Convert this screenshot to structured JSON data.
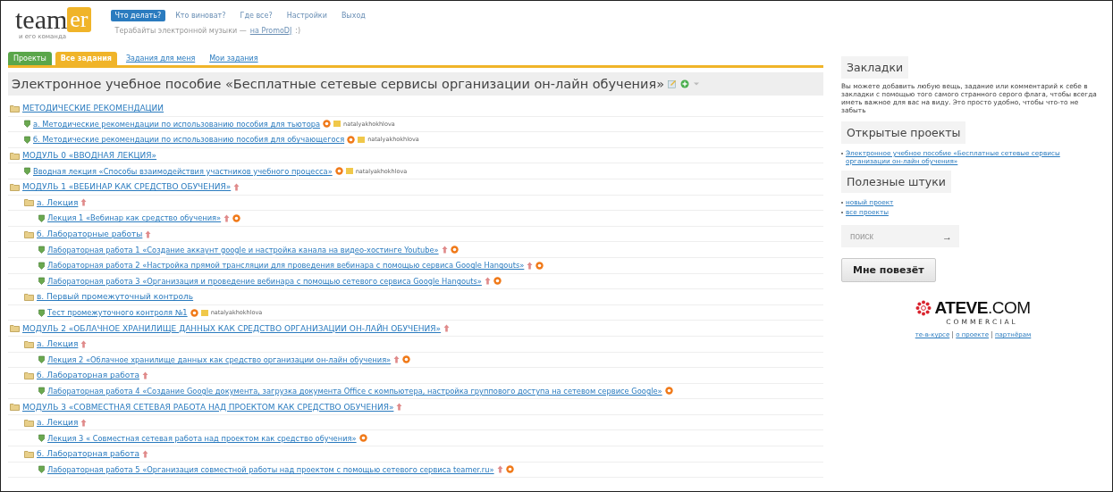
{
  "logo": {
    "word": "team",
    "badge": "er",
    "tagline": "и его команда"
  },
  "nav": [
    {
      "label": "Что делать?",
      "selected": true
    },
    {
      "label": "Кто виноват?",
      "selected": false
    },
    {
      "label": "Где все?",
      "selected": false
    },
    {
      "label": "Настройки",
      "selected": false
    },
    {
      "label": "Выход",
      "selected": false
    }
  ],
  "promo": {
    "text": "Терабайты электронной музыки —",
    "link": "на PromoDJ",
    "smile": ":)"
  },
  "tabs": [
    {
      "label": "Проекты",
      "kind": "green",
      "selected": false
    },
    {
      "label": "Все задания",
      "kind": "yellow",
      "selected": true
    },
    {
      "label": "Задания для меня",
      "kind": "link",
      "selected": false
    },
    {
      "label": "Мои задания",
      "kind": "link",
      "selected": false
    }
  ],
  "project_title": "Электронное учебное пособие «Бесплатные сетевые сервисы организации он-лайн обучения»",
  "tree": [
    {
      "kind": "folder",
      "title": "МЕТОДИЧЕСКИЕ РЕКОМЕНДАЦИИ",
      "up": false,
      "children": [
        {
          "kind": "task",
          "title": "а. Методические рекомендации по использованию пособия для тьютора",
          "up": false,
          "comment": true,
          "author": "natalyakhokhlova"
        },
        {
          "kind": "task",
          "title": "б. Методические рекомендации по использованию пособия для обучающегося",
          "up": false,
          "comment": true,
          "author": "natalyakhokhlova"
        }
      ]
    },
    {
      "kind": "folder",
      "title": "МОДУЛЬ 0 «ВВОДНАЯ ЛЕКЦИЯ»",
      "up": false,
      "children": [
        {
          "kind": "task",
          "title": "Вводная лекция «Способы взаимодействия участников учебного процесса»",
          "up": false,
          "comment": true,
          "author": "natalyakhokhlova"
        }
      ]
    },
    {
      "kind": "folder",
      "title": "МОДУЛЬ 1 «ВЕБИНАР КАК СРЕДСТВО ОБУЧЕНИЯ»",
      "up": true,
      "children": [
        {
          "kind": "folder",
          "title": "а. Лекция",
          "up": true,
          "children": [
            {
              "kind": "task",
              "title": "Лекция 1 «Вебинар как средство обучения»",
              "up": true,
              "comment": true
            }
          ]
        },
        {
          "kind": "folder",
          "title": "б. Лабораторные работы",
          "up": true,
          "children": [
            {
              "kind": "task",
              "title": "Лабораторная работа 1 «Создание аккаунт google и настройка канала на видео-хостинге Youtube»",
              "up": true,
              "comment": true
            },
            {
              "kind": "task",
              "title": "Лабораторная работа 2 «Настройка прямой трансляции для проведения вебинара с помощью сервиса Google Hangouts»",
              "up": true,
              "comment": true
            },
            {
              "kind": "task",
              "title": "Лабораторная работа 3 «Организация и проведение вебинара с помощью сетевого сервиса Google Hangouts»",
              "up": true,
              "comment": true
            }
          ]
        },
        {
          "kind": "folder",
          "title": "в. Первый промежуточный контроль",
          "up": false,
          "children": [
            {
              "kind": "task",
              "title": "Тест промежуточного контроля №1",
              "up": false,
              "comment": true,
              "author": "natalyakhokhlova"
            }
          ]
        }
      ]
    },
    {
      "kind": "folder",
      "title": "МОДУЛЬ 2 «ОБЛАЧНОЕ ХРАНИЛИЩЕ ДАННЫХ КАК СРЕДСТВО ОРГАНИЗАЦИИ ОН-ЛАЙН ОБУЧЕНИЯ»",
      "up": true,
      "children": [
        {
          "kind": "folder",
          "title": "а. Лекция",
          "up": true,
          "children": [
            {
              "kind": "task",
              "title": "Лекция 2 «Облачное хранилище данных как средство организации он-лайн обучения»",
              "up": true,
              "comment": true
            }
          ]
        },
        {
          "kind": "folder",
          "title": "б. Лабораторная работа",
          "up": true,
          "children": [
            {
              "kind": "task",
              "title": "Лабораторная работа 4 «Создание Google документа, загрузка документа Office с компьютера, настройка группового доступа на сетевом сервисе Google»",
              "up": false,
              "comment": true
            }
          ]
        }
      ]
    },
    {
      "kind": "folder",
      "title": "МОДУЛЬ 3 «СОВМЕСТНАЯ СЕТЕВАЯ РАБОТА НАД ПРОЕКТОМ КАК СРЕДСТВО ОБУЧЕНИЯ»",
      "up": true,
      "children": [
        {
          "kind": "folder",
          "title": "а. Лекция",
          "up": true,
          "children": [
            {
              "kind": "task",
              "title": "Лекция 3 « Совместная сетевая работа над проектом как средство обучения»",
              "up": false,
              "comment": true
            }
          ]
        },
        {
          "kind": "folder",
          "title": "б. Лабораторная работа",
          "up": true,
          "children": [
            {
              "kind": "task",
              "title": "Лабораторная работа 5 «Организация совместной работы над проектом с помощью сетевого сервиса teamer.ru»",
              "up": true,
              "comment": true
            }
          ]
        }
      ]
    }
  ],
  "sidebar": {
    "bookmarks": {
      "heading": "Закладки",
      "text": "Вы можете добавить любую вещь, задание или комментарий к себе в закладки с помощью того самого странного серого флага, чтобы всегда иметь важное для вас на виду. Это просто удобно, чтобы что-то не забыть"
    },
    "open_projects": {
      "heading": "Открытые проекты",
      "items": [
        "Электронное учебное пособие «Бесплатные сетевые сервисы организации он-лайн обучения»"
      ]
    },
    "useful": {
      "heading": "Полезные штуки",
      "items": [
        "новый проект",
        "все проекты"
      ]
    },
    "search": {
      "placeholder": "поиск",
      "go": "→"
    },
    "lucky_button": "Мне повезёт",
    "sponsor": {
      "name": "ATEVE",
      "suffix": ".COM",
      "sub": "COMMERCIAL"
    },
    "footer_links": [
      "те-в-курсе",
      "о проекте",
      "партнёрам"
    ]
  }
}
